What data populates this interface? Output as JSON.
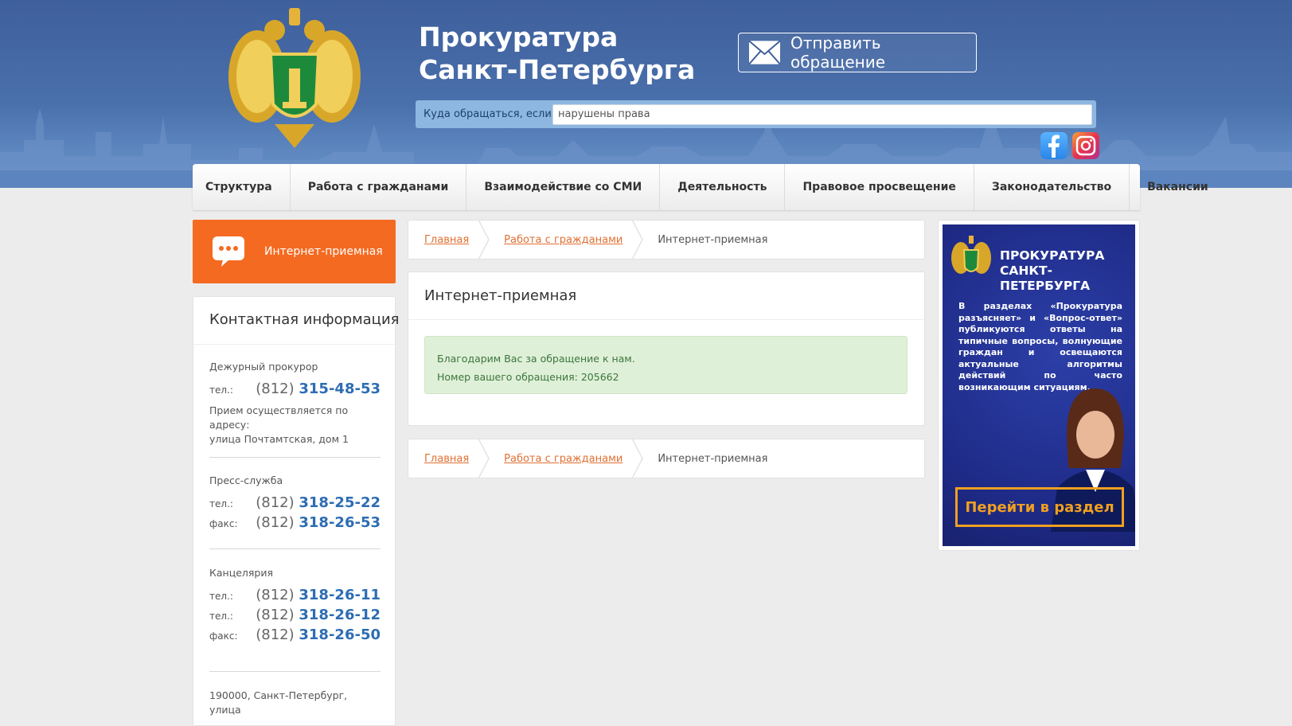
{
  "header": {
    "title_line1": "Прокуратура",
    "title_line2": "Санкт-Петербурга",
    "send_button": "Отправить обращение",
    "search_label": "Куда обращаться, если",
    "search_value": "нарушены права"
  },
  "nav": [
    "Структура",
    "Работа с гражданами",
    "Взаимодействие со СМИ",
    "Деятельность",
    "Правовое просвещение",
    "Законодательство",
    "Вакансии"
  ],
  "left": {
    "internet_button": "Интернет-приемная",
    "contact_title": "Контактная информация",
    "duty": {
      "head": "Дежурный прокурор",
      "tel_key": "тел.:",
      "tel_code": "(812)",
      "tel_num": "315-48-53",
      "note_line1": "Прием осуществляется по адресу:",
      "note_line2": "улица Почтамтская, дом 1"
    },
    "press": {
      "head": "Пресс-служба",
      "tel_key": "тел.:",
      "tel_code": "(812)",
      "tel_num": "318-25-22",
      "fax_key": "факс:",
      "fax_code": "(812)",
      "fax_num": "318-26-53"
    },
    "office": {
      "head": "Канцелярия",
      "tel1_key": "тел.:",
      "tel1_code": "(812)",
      "tel1_num": "318-26-11",
      "tel2_key": "тел.:",
      "tel2_code": "(812)",
      "tel2_num": "318-26-12",
      "fax_key": "факс:",
      "fax_code": "(812)",
      "fax_num": "318-26-50"
    },
    "address_partial": "190000, Санкт-Петербург, улица"
  },
  "breadcrumb": {
    "home": "Главная",
    "section": "Работа с гражданами",
    "current": "Интернет-приемная"
  },
  "content": {
    "title": "Интернет-приемная",
    "alert_line1": "Благодарим Вас за обращение к нам.",
    "alert_line2": "Номер вашего обращения: 205662"
  },
  "banner": {
    "title_line1": "ПРОКУРАТУРА",
    "title_line2": "САНКТ-ПЕТЕРБУРГА",
    "body": "В разделах «Прокуратура разъясняет» и «Вопрос-ответ» публикуются ответы на типичные вопросы, волнующие граждан и освещаются актуальные алгоритмы действий по часто возникающим ситуациям.",
    "button": "Перейти в раздел"
  },
  "colors": {
    "header_blue": "#3e5f9b",
    "accent_orange": "#f56a21",
    "link_blue": "#2d6db3",
    "alert_green_bg": "#dff0d8",
    "banner_blue": "#1e2a86"
  }
}
